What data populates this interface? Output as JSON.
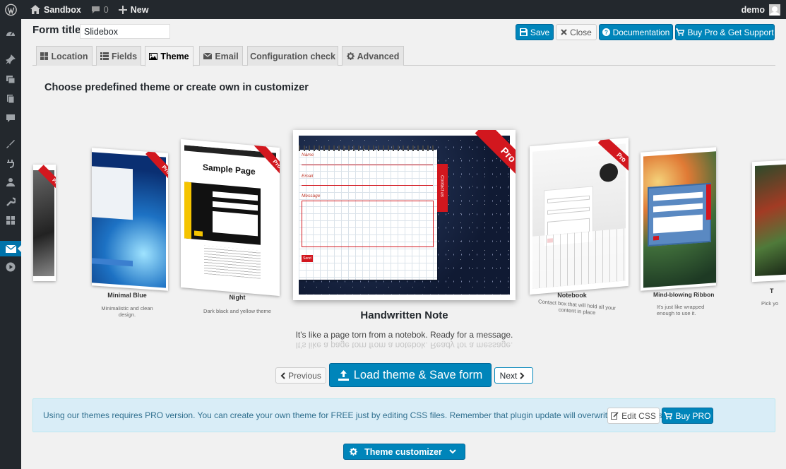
{
  "adminbar": {
    "site_name": "Sandbox",
    "comments_count": "0",
    "new_label": "New",
    "user_name": "demo"
  },
  "form": {
    "title_label": "Form title",
    "title_value": "Slidebox"
  },
  "toolbar": {
    "save_label": "Save",
    "close_label": "Close",
    "documentation_label": "Documentation",
    "buy_pro_support_label": "Buy Pro & Get Support"
  },
  "tabs": [
    {
      "label": "Location",
      "icon": "grid-icon"
    },
    {
      "label": "Fields",
      "icon": "list-icon"
    },
    {
      "label": "Theme",
      "icon": "image-icon",
      "active": true
    },
    {
      "label": "Email",
      "icon": "envelope-icon"
    },
    {
      "label": "Configuration check",
      "icon": ""
    },
    {
      "label": "Advanced",
      "icon": "gear-icon"
    }
  ],
  "theme_section": {
    "heading": "Choose predefined theme or create own in customizer",
    "ribbon_text": "Pro",
    "themes": [
      {
        "name": "Minimal Blue",
        "description": "Minimalistic and clean design."
      },
      {
        "name": "Night",
        "description": "Dark black and yellow theme"
      },
      {
        "name": "Handwritten Note",
        "description": "It's like a page torn from a notebok. Ready for a message."
      },
      {
        "name": "Notebook",
        "description": "Contact box that will hold all your content in place"
      },
      {
        "name": "Mind-blowing Ribbon",
        "description": "It's just like wrapped enough to use it."
      },
      {
        "name": "T",
        "description": "Pick yo"
      }
    ],
    "preview_texts": {
      "sample_page": "Sample Page",
      "contact_us": "Contact us",
      "name_field": "Name",
      "email_field": "Email",
      "message_field": "Message",
      "send_button": "Send"
    }
  },
  "nav": {
    "previous_label": "Previous",
    "load_label": "Load theme & Save form",
    "next_label": "Next"
  },
  "notice": {
    "text": "Using our themes requires PRO version. You can create your own theme for FREE just by editing CSS files. Remember that plugin update will overwrite any changes!",
    "edit_css_label": "Edit CSS",
    "buy_pro_label": "Buy PRO"
  },
  "customizer": {
    "label": "Theme customizer"
  },
  "colors": {
    "admin_bar": "#23282d",
    "primary": "#0085ba",
    "ribbon": "#d2171e",
    "notice_bg": "#d9edf7",
    "night_yellow": "#f5c400"
  }
}
